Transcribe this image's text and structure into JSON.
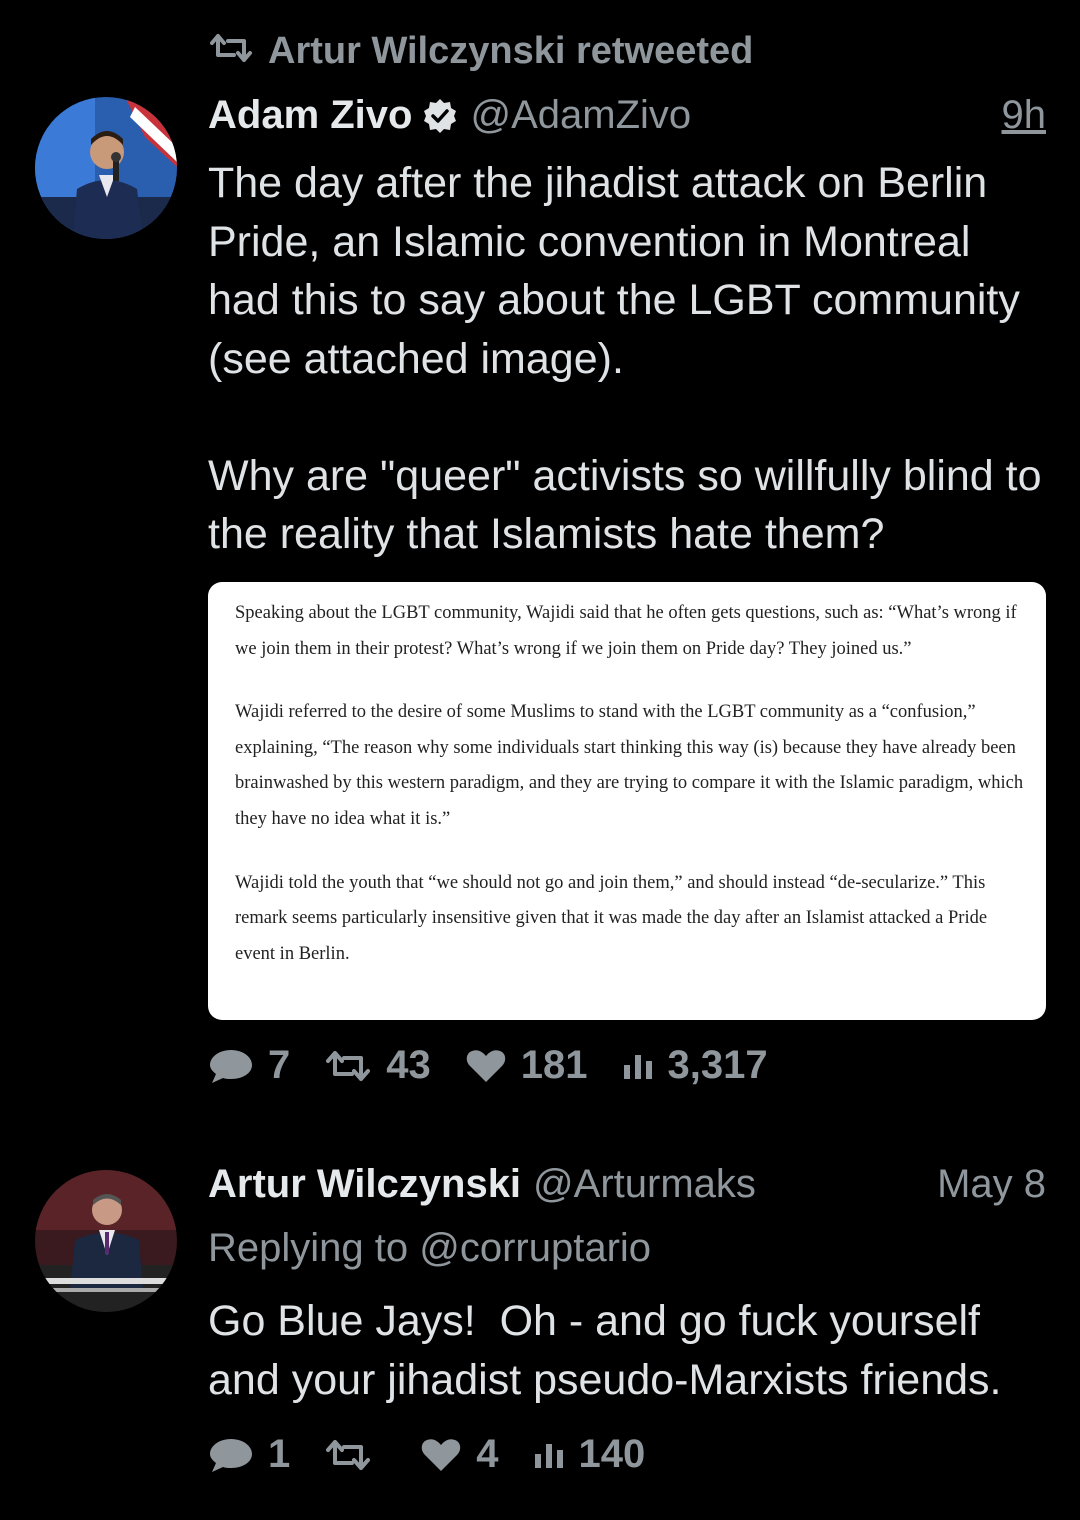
{
  "retweet_context": {
    "text": "Artur Wilczynski retweeted"
  },
  "tweets": [
    {
      "author_name": "Adam Zivo",
      "handle": "@AdamZivo",
      "time": "9h",
      "verified": true,
      "text": "The day after the jihadist attack on Berlin Pride, an Islamic convention in Montreal had this to say about the LGBT community (see attached image).\n\nWhy are \"queer\" activists so willfully blind to the reality that Islamists hate them?",
      "quote": {
        "paragraphs": [
          "Speaking about the LGBT community, Wajidi said that he often gets questions, such as: “What’s wrong if we join them in their protest? What’s wrong if we join them on Pride day? They joined us.”",
          "Wajidi referred to the desire of some Muslims to stand with the LGBT community as a “confusion,” explaining, “The reason why some individuals start thinking this way (is) because they have already been brainwashed by this western paradigm, and they are trying to compare it with the Islamic paradigm, which they have no idea what it is.”",
          "Wajidi told the youth that “we should not go and join them,” and should instead “de-secularize.” This remark seems particularly insensitive given that it was made the day after an Islamist attacked a Pride event in Berlin."
        ]
      },
      "stats": {
        "replies": "7",
        "retweets": "43",
        "likes": "181",
        "views": "3,317"
      }
    },
    {
      "author_name": "Artur Wilczynski",
      "handle": "@Arturmaks",
      "time": "May 8",
      "verified": false,
      "replying_label": "Replying to",
      "replying_to": "@corruptario",
      "text": "Go Blue Jays!  Oh - and go fuck yourself and your jihadist pseudo-Marxists friends.",
      "stats": {
        "replies": "1",
        "retweets": "",
        "likes": "4",
        "views": "140"
      }
    }
  ],
  "icons": {
    "reply": "speech-bubble-icon",
    "retweet": "retweet-arrows-icon",
    "like": "heart-icon",
    "views": "bar-chart-icon",
    "verified": "verified-check-icon"
  },
  "colors": {
    "background": "#000000",
    "text": "#dfe3e6",
    "muted": "#8f979d",
    "verified_badge": "#dfe3e6"
  }
}
